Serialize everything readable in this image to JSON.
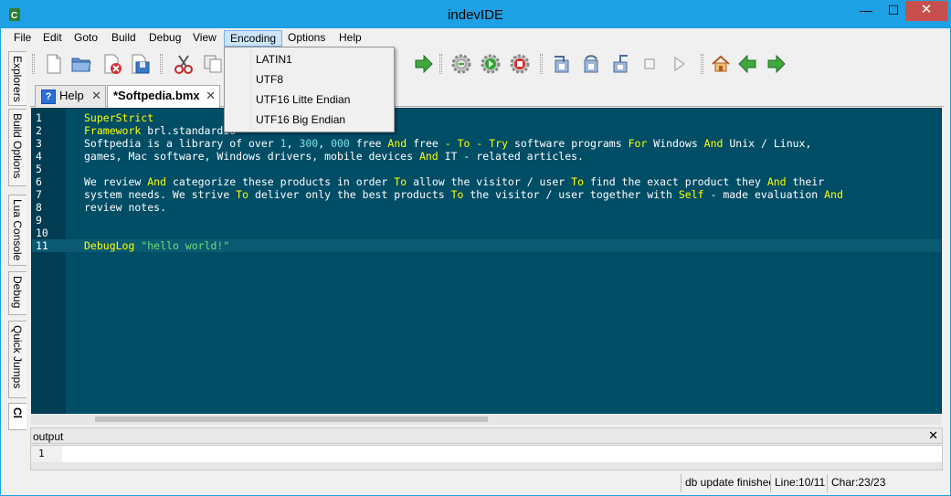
{
  "window": {
    "title": "indevIDE",
    "minimize": "—",
    "maximize": "☐",
    "close": "✕"
  },
  "menubar": [
    "File",
    "Edit",
    "Goto",
    "Build",
    "Debug",
    "View",
    "Encoding",
    "Options",
    "Help"
  ],
  "encoding_menu": [
    "LATIN1",
    "UTF8",
    "UTF16 Litte Endian",
    "UTF16 Big Endian"
  ],
  "side_tabs": [
    "Explorers",
    "Build Options",
    "Lua Console",
    "Debug",
    "Quick Jumps",
    "Cl"
  ],
  "toolbar_icons": [
    "new-file-icon",
    "open-folder-icon",
    "close-file-icon",
    "save-icon",
    "cut-icon",
    "copy-icon",
    "paste-icon",
    "build-icon",
    "build-run-icon",
    "gear-icon",
    "gear-run-icon",
    "gear-stop-icon",
    "step-into-icon",
    "step-over-icon",
    "step-out-icon",
    "stop-icon",
    "continue-icon",
    "home-icon",
    "back-icon",
    "forward-icon"
  ],
  "doc_tabs": [
    {
      "label": "Help",
      "close": "✕"
    },
    {
      "label": "*Softpedia.bmx",
      "close": "✕"
    }
  ],
  "editor": {
    "line_numbers": [
      "1",
      "2",
      "3",
      "4",
      "5",
      "6",
      "7",
      "8",
      "9",
      "10",
      "11"
    ],
    "lines": [
      [
        {
          "t": "SuperStrict",
          "c": "kw"
        }
      ],
      [
        {
          "t": "Framework",
          "c": "kw"
        },
        {
          "t": " brl.standardio",
          "c": "op"
        }
      ],
      [
        {
          "t": "Softpedia is a library of over ",
          "c": "op"
        },
        {
          "t": "1",
          "c": "num"
        },
        {
          "t": ", ",
          "c": "op"
        },
        {
          "t": "300",
          "c": "num"
        },
        {
          "t": ", ",
          "c": "op"
        },
        {
          "t": "000",
          "c": "num"
        },
        {
          "t": " free ",
          "c": "op"
        },
        {
          "t": "And",
          "c": "kw"
        },
        {
          "t": " free ",
          "c": "op"
        },
        {
          "t": "- ",
          "c": "kw"
        },
        {
          "t": "To",
          "c": "kw"
        },
        {
          "t": " - ",
          "c": "kw"
        },
        {
          "t": "Try",
          "c": "kw"
        },
        {
          "t": " software programs ",
          "c": "op"
        },
        {
          "t": "For",
          "c": "kw"
        },
        {
          "t": " Windows ",
          "c": "op"
        },
        {
          "t": "And",
          "c": "kw"
        },
        {
          "t": " Unix / Linux,",
          "c": "op"
        }
      ],
      [
        {
          "t": "games, Mac software, Windows drivers, mobile devices ",
          "c": "op"
        },
        {
          "t": "And",
          "c": "kw"
        },
        {
          "t": " IT - related articles.",
          "c": "op"
        }
      ],
      [],
      [
        {
          "t": "We review ",
          "c": "op"
        },
        {
          "t": "And",
          "c": "kw"
        },
        {
          "t": " categorize these products in order ",
          "c": "op"
        },
        {
          "t": "To",
          "c": "kw"
        },
        {
          "t": " allow the visitor / user ",
          "c": "op"
        },
        {
          "t": "To",
          "c": "kw"
        },
        {
          "t": " find the exact product they ",
          "c": "op"
        },
        {
          "t": "And",
          "c": "kw"
        },
        {
          "t": " their",
          "c": "op"
        }
      ],
      [
        {
          "t": "system needs. We strive ",
          "c": "op"
        },
        {
          "t": "To",
          "c": "kw"
        },
        {
          "t": " deliver only the best products ",
          "c": "op"
        },
        {
          "t": "To",
          "c": "kw"
        },
        {
          "t": " the visitor / user together with ",
          "c": "op"
        },
        {
          "t": "Self",
          "c": "kw"
        },
        {
          "t": " - made evaluation ",
          "c": "op"
        },
        {
          "t": "And",
          "c": "kw"
        }
      ],
      [
        {
          "t": "review notes.",
          "c": "op"
        }
      ],
      [],
      [],
      [
        {
          "t": "DebugLog",
          "c": "kw"
        },
        {
          "t": " ",
          "c": "op"
        },
        {
          "t": "\"hello world!\"",
          "c": "str"
        }
      ]
    ]
  },
  "output": {
    "title": "output",
    "close": "✕",
    "line_number": "1"
  },
  "status": {
    "message": "db update finished",
    "line": "Line:10/11",
    "char": "Char:23/23"
  }
}
